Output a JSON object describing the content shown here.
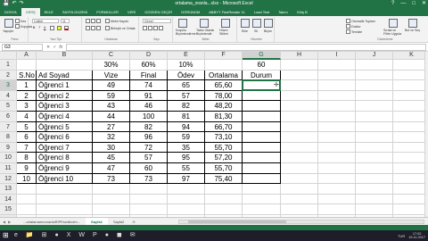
{
  "window": {
    "title": "ortalama_oranla...xlsx - Microsoft Excel",
    "controls": [
      "?",
      "—",
      "□",
      "✕"
    ]
  },
  "quick_access": [
    "💾",
    "↶",
    "↷"
  ],
  "ribbon_tabs": [
    "DOSYA",
    "GİRİŞ",
    "EKLE",
    "SAYFA DÜZENİ",
    "FORMÜLLER",
    "VERİ",
    "GÖZDEN GEÇİR",
    "GÖRÜNÜM",
    "ABBYY FineReader 11",
    "Load Test",
    "Takım",
    "Giriş B"
  ],
  "active_tab_index": 1,
  "ribbon": {
    "clipboard": {
      "label": "Pano",
      "paste": "Yapıştır",
      "cut": "Kes",
      "copy": "Kopyala",
      "format": "Biçim Boyacısı"
    },
    "font": {
      "label": "Yazı Tipi",
      "name": "Calibri",
      "size": "11",
      "bold": "K",
      "italic": "T",
      "underline": "A"
    },
    "alignment": {
      "label": "Hizalama",
      "wrap": "Metni Kaydır",
      "merge": "Birleştir ve Ortala"
    },
    "number": {
      "label": "Sayı",
      "format": "Genel"
    },
    "styles": {
      "label": "Stiller",
      "conditional": "Koşullu Biçimlendirme",
      "table": "Tablo Olarak Biçimlendir",
      "cell_styles": "Hücre Stilleri"
    },
    "cells": {
      "label": "Hücreler",
      "insert": "Ekle",
      "delete": "Sil",
      "format": "Biçim"
    },
    "editing": {
      "label": "Düzenleme",
      "autosum": "Otomatik Toplam",
      "fill": "Doldur",
      "clear": "Temizle",
      "sort": "Sırala ve Filtre Uygula",
      "find": "Bul ve Seç"
    }
  },
  "formula_bar": {
    "name_box": "G3",
    "value": "",
    "cancel": "✕",
    "enter": "✓",
    "fx": "fx"
  },
  "columns": [
    "A",
    "B",
    "C",
    "D",
    "E",
    "F",
    "G",
    "H",
    "I",
    "J",
    "K"
  ],
  "selected_column": "G",
  "rows": [
    "1",
    "2",
    "3",
    "4",
    "5",
    "6",
    "7",
    "8",
    "9",
    "10",
    "11",
    "12",
    "13",
    "14",
    "15",
    "16"
  ],
  "selected_row": "3",
  "row1": {
    "c": "30%",
    "d": "60%",
    "e": "10%",
    "g": "60"
  },
  "header_row": {
    "a": "S.No",
    "b": "Ad Soyad",
    "c": "Vize",
    "d": "Final",
    "e": "Ödev",
    "f": "Ortalama",
    "g": "Durum"
  },
  "data_rows": [
    {
      "a": "1",
      "b": "Öğrenci 1",
      "c": "49",
      "d": "74",
      "e": "65",
      "f": "65,60"
    },
    {
      "a": "2",
      "b": "Öğrenci 2",
      "c": "59",
      "d": "91",
      "e": "57",
      "f": "78,00"
    },
    {
      "a": "3",
      "b": "Öğrenci 3",
      "c": "43",
      "d": "46",
      "e": "82",
      "f": "48,20"
    },
    {
      "a": "4",
      "b": "Öğrenci 4",
      "c": "44",
      "d": "100",
      "e": "81",
      "f": "81,30"
    },
    {
      "a": "5",
      "b": "Öğrenci 5",
      "c": "27",
      "d": "82",
      "e": "94",
      "f": "66,70"
    },
    {
      "a": "6",
      "b": "Öğrenci 6",
      "c": "32",
      "d": "96",
      "e": "59",
      "f": "73,10"
    },
    {
      "a": "7",
      "b": "Öğrenci 7",
      "c": "30",
      "d": "72",
      "e": "35",
      "f": "55,70"
    },
    {
      "a": "8",
      "b": "Öğrenci 8",
      "c": "45",
      "d": "57",
      "e": "95",
      "f": "57,20"
    },
    {
      "a": "9",
      "b": "Öğrenci 9",
      "c": "47",
      "d": "60",
      "e": "55",
      "f": "55,70"
    },
    {
      "a": "10",
      "b": "Öğrenci 10",
      "c": "73",
      "d": "73",
      "e": "97",
      "f": "75,40"
    }
  ],
  "sheet_tabs": [
    "...ortalamanınoranlaRIPEsedikolm...",
    "Sayfa1",
    "Sayfa2"
  ],
  "active_sheet_index": 1,
  "sheet_add": "⊕",
  "taskbar": {
    "apps": [
      "e",
      "📁",
      "⊞",
      "●",
      "X",
      "W",
      "P",
      "●",
      "◼",
      "✉"
    ],
    "lang": "TUR",
    "time": "17:02",
    "date": "15.11.2017"
  },
  "colors": {
    "excel_green": "#217346",
    "grid_line": "#d4d4d4",
    "header_bg": "#ececec"
  }
}
